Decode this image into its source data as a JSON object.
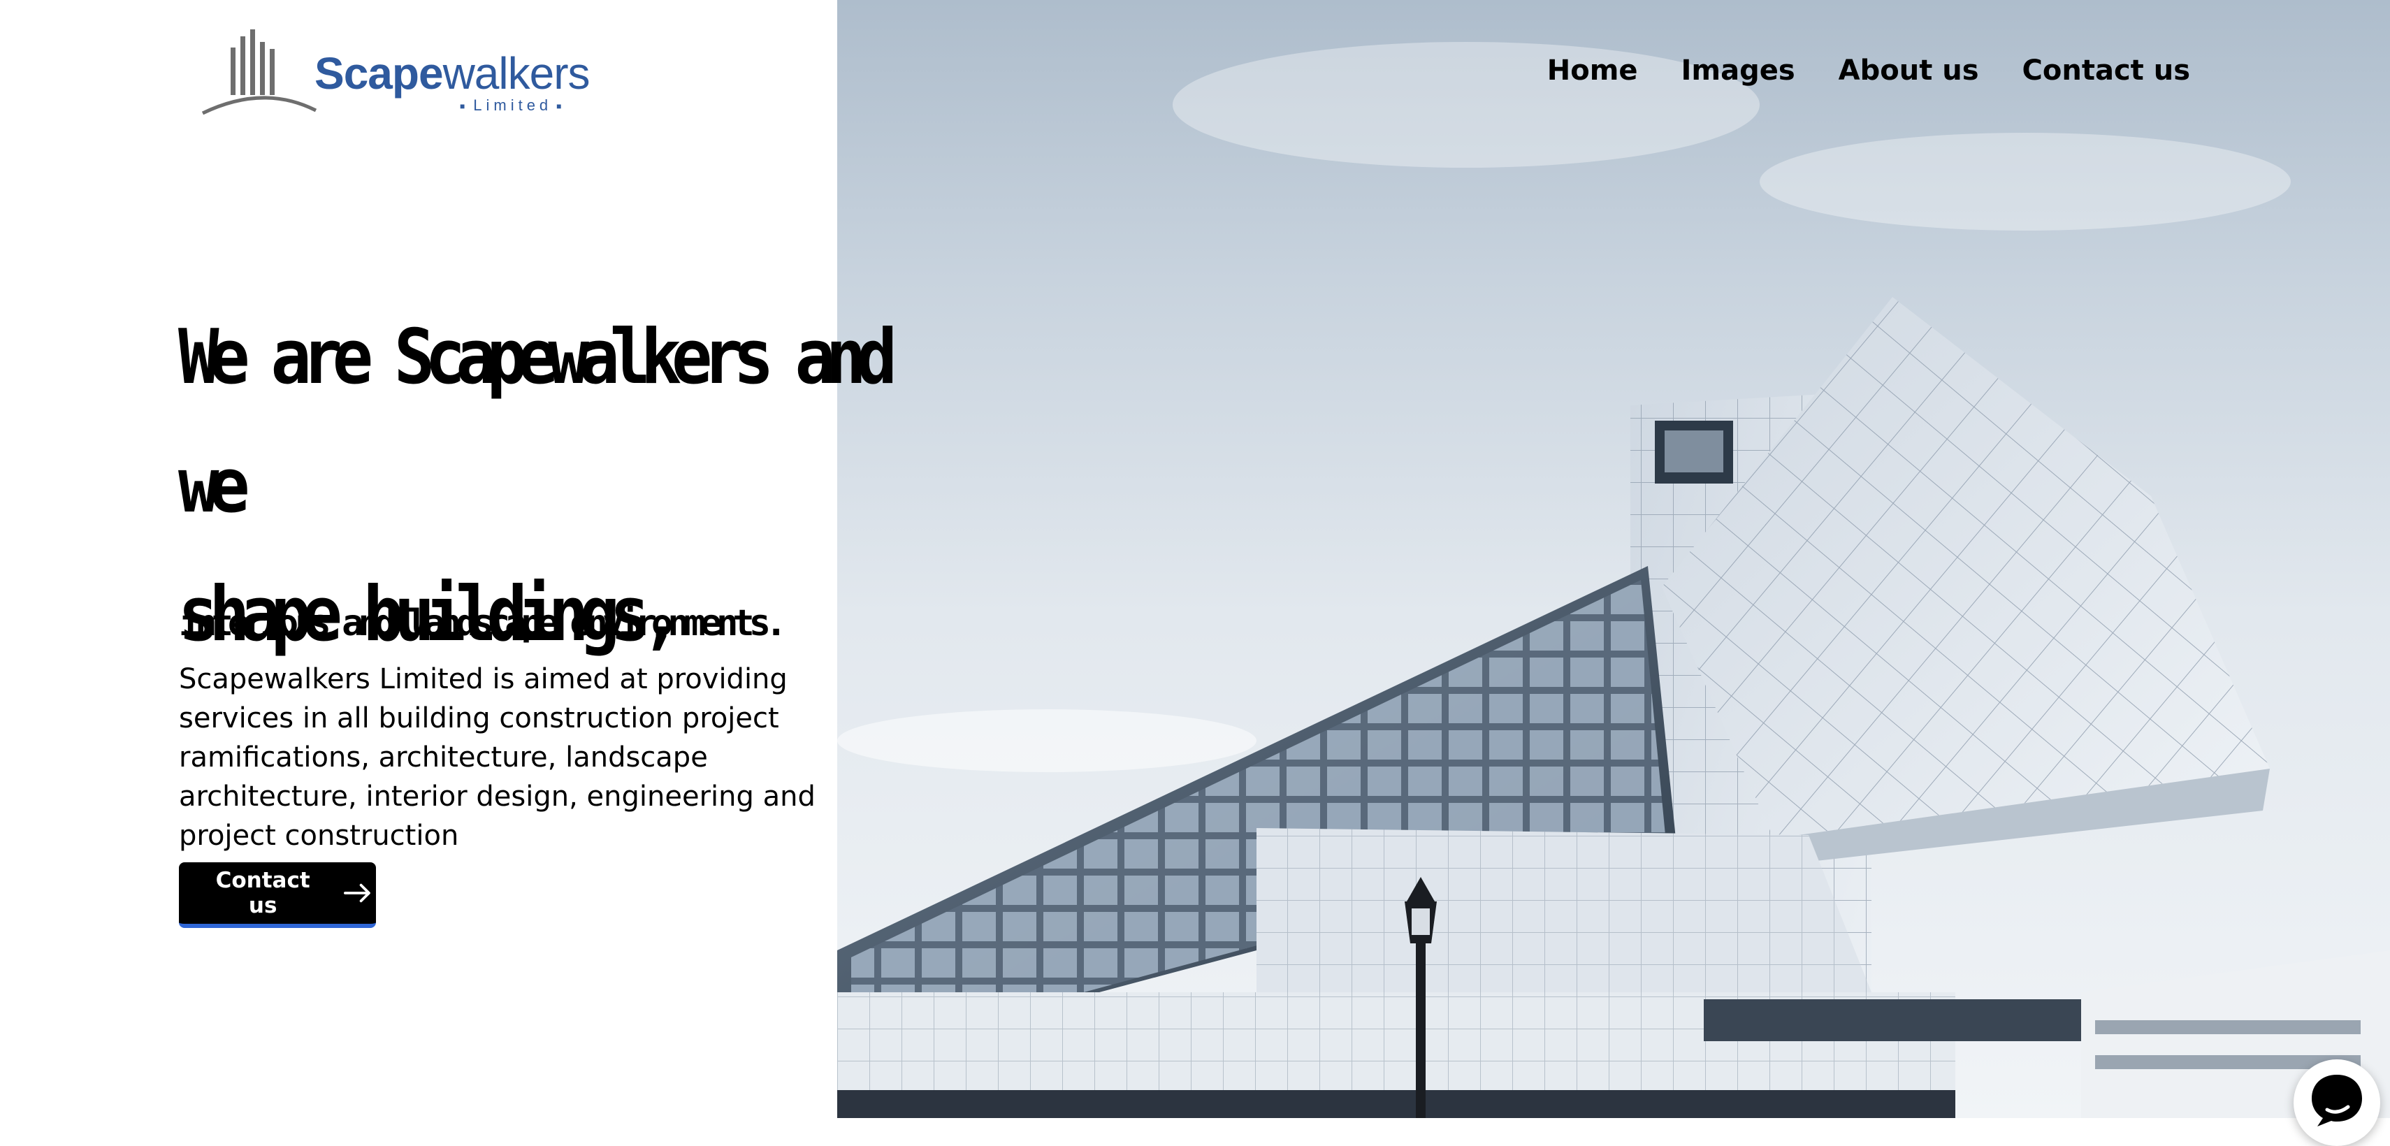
{
  "logo": {
    "brand_bold": "Scape",
    "brand_rest": "walkers",
    "subtitle": "Limited",
    "color": "#2f5a9e",
    "icon": "skyline-bars-icon"
  },
  "nav": {
    "items": [
      "Home",
      "Images",
      "About us",
      "Contact us"
    ]
  },
  "hero": {
    "headline_line1": "We are Scapewalkers and we",
    "headline_line2": "shape buildings,",
    "subheadline": "interiors and landscape environments.",
    "description": "Scapewalkers Limited is aimed at providing services in all building construction project ramifications, architecture, landscape architecture, interior design, engineering and project construction",
    "cta_label": "Contact us",
    "cta_icon": "arrow-right-icon",
    "image": "modern-glass-building-photo"
  },
  "chat": {
    "icon": "chat-bubble-icon"
  },
  "colors": {
    "accent": "#2f66d6",
    "button_bg": "#000000",
    "brand": "#2f5a9e"
  }
}
